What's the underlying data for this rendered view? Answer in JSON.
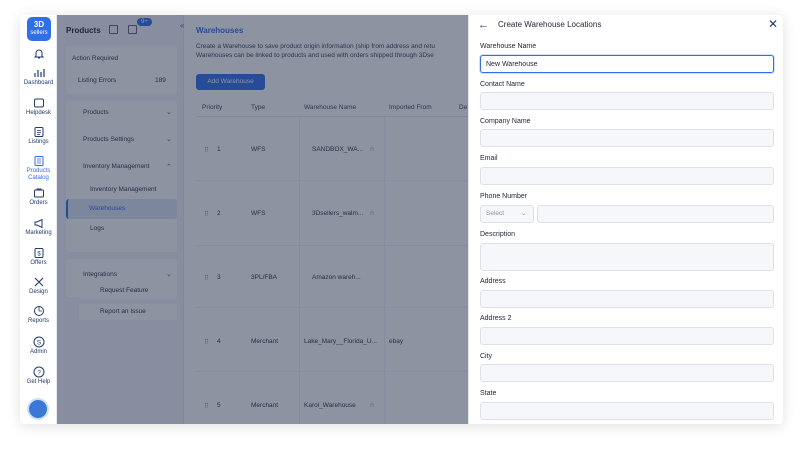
{
  "brand": {
    "line1": "3D",
    "line2": "sellers"
  },
  "rail": [
    {
      "label": ""
    },
    {
      "label": "Dashboard"
    },
    {
      "label": "Helpdesk"
    },
    {
      "label": "Listings"
    },
    {
      "label": "Products Catalog"
    },
    {
      "label": "Orders"
    },
    {
      "label": "Marketing"
    },
    {
      "label": "Offers"
    },
    {
      "label": "Design"
    },
    {
      "label": "Reports"
    },
    {
      "label": "Admin"
    },
    {
      "label": "Get Help"
    }
  ],
  "subnav": {
    "title": "Products",
    "badge": "9+",
    "action_required": "Action Required",
    "listing_errors": "Listing Errors",
    "listing_errors_count": "189",
    "products": "Products",
    "products_settings": "Products Settings",
    "inventory_management": "Inventory Management",
    "inventory_management_item": "Inventory Management",
    "warehouses": "Warehouses",
    "logs": "Logs",
    "integrations": "Integrations",
    "request_feature": "Request Feature",
    "report_issue": "Report an Issue"
  },
  "main": {
    "title": "Warehouses",
    "desc1": "Create a Warehouse to save product origin information (ship from address and retu",
    "desc2": "Warehouses can be linked to products and used with orders shipped through 3Dse",
    "add_button": "Add Warehouse",
    "columns": [
      "Priority",
      "Type",
      "Warehouse Name",
      "Imported From",
      "De"
    ],
    "rows": [
      {
        "priority": "1",
        "type": "WFS",
        "name": "SANDBOX_WA...",
        "imported": ""
      },
      {
        "priority": "2",
        "type": "WFS",
        "name": "3Dsellers_walm...",
        "imported": ""
      },
      {
        "priority": "3",
        "type": "3PL/FBA",
        "name": "Amazon wareh...",
        "imported": ""
      },
      {
        "priority": "4",
        "type": "Merchant",
        "name": "Lake_Mary__Florida_U...",
        "imported": "ebay"
      },
      {
        "priority": "5",
        "type": "Merchant",
        "name": "Karol_Warehouse",
        "imported": ""
      }
    ]
  },
  "drawer": {
    "title": "Create Warehouse Locations",
    "fields": {
      "warehouse_name": {
        "label": "Warehouse Name",
        "value": "New Warehouse"
      },
      "contact_name": {
        "label": "Contact Name",
        "value": ""
      },
      "company_name": {
        "label": "Company Name",
        "value": ""
      },
      "email": {
        "label": "Email",
        "value": ""
      },
      "phone": {
        "label": "Phone Number",
        "select": "Select",
        "value": ""
      },
      "description": {
        "label": "Description",
        "value": ""
      },
      "address": {
        "label": "Address",
        "value": ""
      },
      "address2": {
        "label": "Address 2",
        "value": ""
      },
      "city": {
        "label": "City",
        "value": ""
      },
      "state": {
        "label": "State",
        "value": ""
      }
    }
  },
  "colors": {
    "accent": "#2f6fe8",
    "overlay": "#1e2846"
  }
}
